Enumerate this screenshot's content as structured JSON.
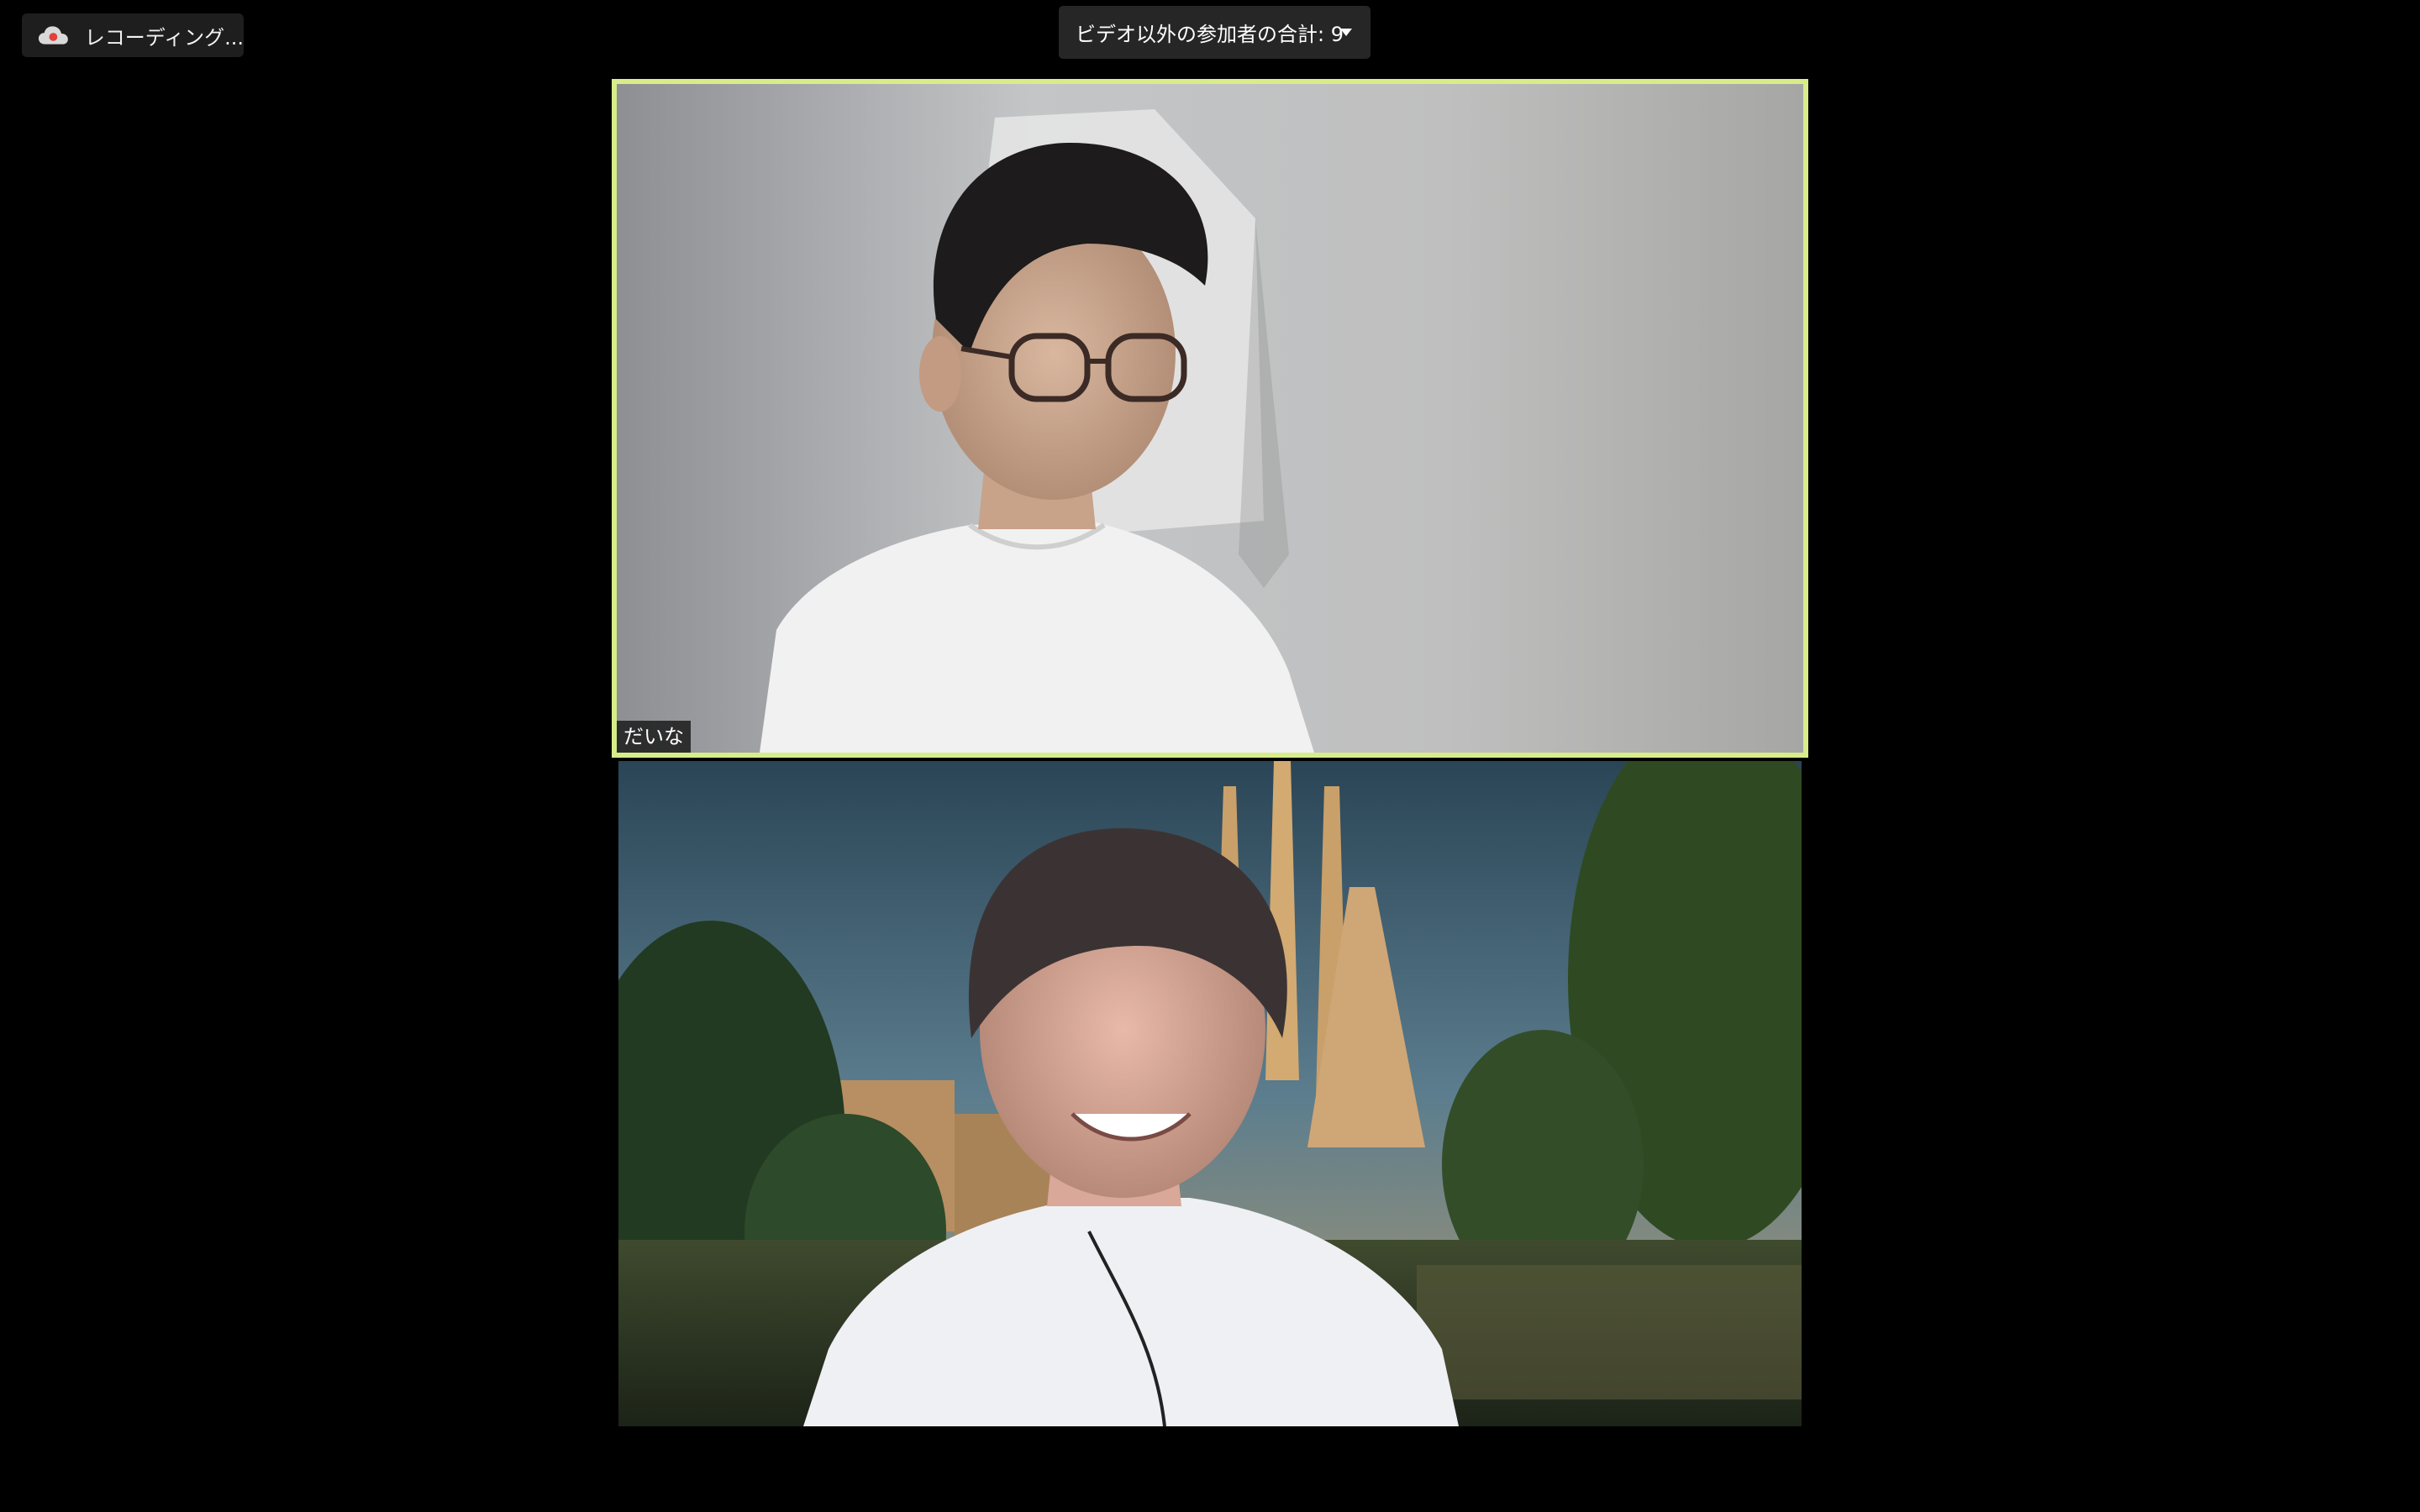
{
  "recording": {
    "label": "レコーディング...",
    "icon": "cloud-recording-icon",
    "dot_color": "#e0413a"
  },
  "participants_bar": {
    "label": "ビデオ以外の参加者の合計: 9",
    "icon": "chevron-down-icon"
  },
  "tiles": [
    {
      "name": "だいな",
      "active_speaker": true,
      "highlight_color": "#d8ec8a"
    },
    {
      "name": "",
      "active_speaker": false
    }
  ],
  "colors": {
    "background": "#000000",
    "pill_bg": "#1e1e1e",
    "dropdown_bg": "#262626"
  }
}
